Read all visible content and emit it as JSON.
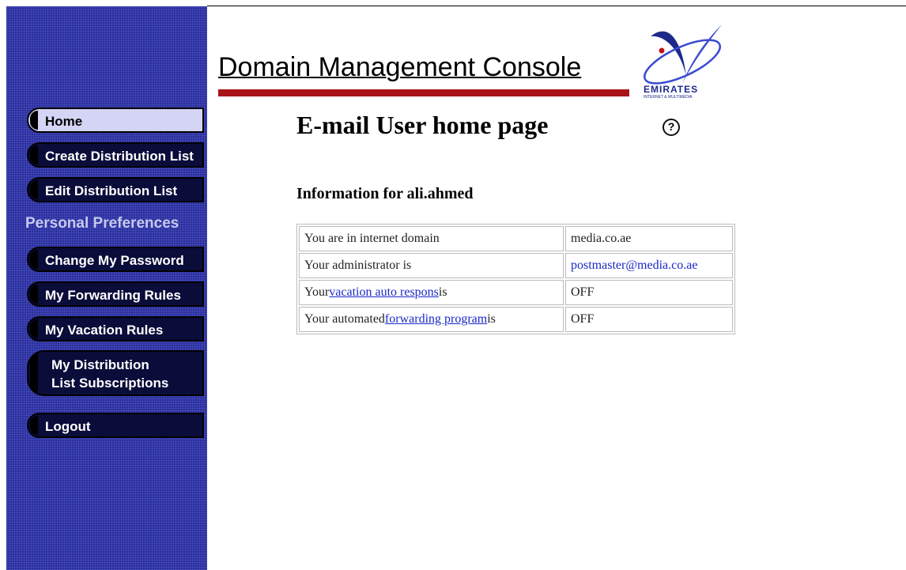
{
  "header": {
    "title": "Domain Management Console",
    "logo_text": "EMIRATES",
    "logo_subtext": "INTERNET & MULTIMEDIA"
  },
  "nav": {
    "home": "Home",
    "create_list": "Create Distribution List",
    "edit_list": "Edit Distribution List",
    "section_label": "Personal Preferences",
    "change_password": "Change My Password",
    "forwarding_rules": "My Forwarding Rules",
    "vacation_rules": "My Vacation Rules",
    "list_subscriptions_line1": "My Distribution",
    "list_subscriptions_line2": "List Subscriptions",
    "logout": "Logout"
  },
  "main": {
    "title": "E-mail User home page",
    "help_icon": "?",
    "info_heading": "Information for ali.ahmed",
    "rows": [
      {
        "label_prefix": "You are in internet domain",
        "link": "",
        "label_suffix": "",
        "value": "media.co.ae"
      },
      {
        "label_prefix": "Your administrator is",
        "link": "",
        "label_suffix": "",
        "value": "postmaster@media.co.ae"
      },
      {
        "label_prefix": "Your",
        "link": "vacation auto respons",
        "label_suffix": "is",
        "value": "OFF"
      },
      {
        "label_prefix": "Your automated",
        "link": "forwarding program",
        "label_suffix": "is",
        "value": "OFF"
      }
    ]
  },
  "colors": {
    "sidebar": "#2a2f9a",
    "button": "#0a0c3a",
    "active_button": "#d4d4f5",
    "red_bar": "#a91418",
    "link": "#1a28c8"
  }
}
